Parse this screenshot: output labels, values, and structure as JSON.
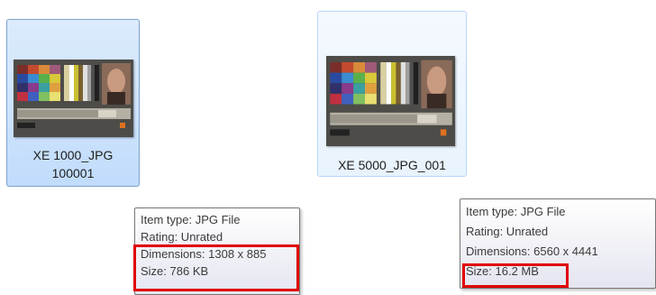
{
  "files": [
    {
      "name_line1": "XE 1000_JPG",
      "name_line2": "100001",
      "state": "selected",
      "thumbnail": "color-chart-thumbnail"
    },
    {
      "name_line1": "XE 5000_JPG_001",
      "state": "hover",
      "thumbnail": "color-chart-thumbnail"
    }
  ],
  "tooltips": [
    {
      "item_type": "Item type: JPG File",
      "rating": "Rating: Unrated",
      "dimensions": "Dimensions: 1308 x 885",
      "size": "Size: 786 KB"
    },
    {
      "item_type": "Item type: JPG File",
      "rating": "Rating: Unrated",
      "dimensions": "Dimensions: 6560 x 4441",
      "size": "Size: 16.2 MB"
    }
  ],
  "colors": {
    "highlight_border": "#e00000",
    "selection_fill": "#c1dcfc",
    "hover_fill": "#e8f3fd"
  }
}
